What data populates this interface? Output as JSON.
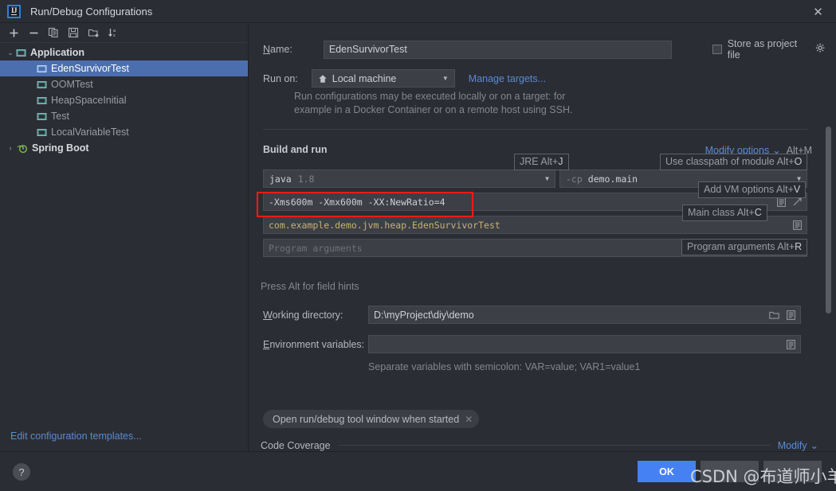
{
  "window": {
    "title": "Run/Debug Configurations",
    "logo_text": "IJ",
    "close_label": "✕"
  },
  "toolbar": {
    "items": [
      {
        "name": "add-configuration-button",
        "icon": "plus-icon",
        "label": "+"
      },
      {
        "name": "remove-configuration-button",
        "icon": "minus-icon",
        "label": "−"
      },
      {
        "name": "copy-configuration-button",
        "icon": "copy-icon",
        "label": ""
      },
      {
        "name": "save-configuration-button",
        "icon": "save-icon",
        "label": ""
      },
      {
        "name": "new-folder-button",
        "icon": "folder-add-icon",
        "label": ""
      },
      {
        "name": "sort-configurations-button",
        "icon": "sort-alphabetical-icon",
        "label": ""
      }
    ]
  },
  "sidebar": {
    "groups": [
      {
        "label": "Application",
        "expanded": true,
        "twisty": "⌄",
        "children": [
          {
            "label": "EdenSurvivorTest",
            "selected": true
          },
          {
            "label": "OOMTest",
            "selected": false
          },
          {
            "label": "HeapSpaceInitial",
            "selected": false
          },
          {
            "label": "Test",
            "selected": false
          },
          {
            "label": "LocalVariableTest",
            "selected": false
          }
        ]
      },
      {
        "label": "Spring Boot",
        "expanded": false,
        "twisty": "›",
        "children": []
      }
    ],
    "edit_templates_label": "Edit configuration templates..."
  },
  "form": {
    "name_label": "Name:",
    "name_value": "EdenSurvivorTest",
    "store_as_project_file_label": "Store as project file",
    "store_as_project_file_checked": false,
    "gear_icon": "gear-icon",
    "run_on_label": "Run on:",
    "run_on_value": "Local machine",
    "run_on_icon": "home-icon",
    "manage_targets_label": "Manage targets...",
    "run_on_hint_line1": "Run configurations may be executed locally or on a target: for",
    "run_on_hint_line2": "example in a Docker Container or on a remote host using SSH.",
    "build_and_run_label": "Build and run",
    "modify_options_label": "Modify options",
    "modify_options_chevron": "⌄",
    "modify_options_shortcut": "Alt+M",
    "jre_value": "java",
    "jre_version": "1.8",
    "classpath_prefix": "-cp",
    "classpath_value": "demo.main",
    "vm_options_value": "-Xms600m -Xmx600m -XX:NewRatio=4",
    "main_class_value": "com.example.demo.jvm.heap.EdenSurvivorTest",
    "program_arguments_placeholder": "Program arguments",
    "press_alt_hint": "Press Alt for field hints",
    "working_directory_label": "Working directory:",
    "working_directory_value": "D:\\myProject\\diy\\demo",
    "environment_variables_label": "Environment variables:",
    "environment_variables_value": "",
    "environment_hint": "Separate variables with semicolon: VAR=value; VAR1=value1",
    "open_tool_window_chip": "Open run/debug tool window when started",
    "chip_close": "✕",
    "code_coverage_label": "Code Coverage",
    "code_coverage_modify_label": "Modify",
    "code_coverage_modify_chevron": "⌄"
  },
  "tooltips": [
    {
      "name": "jre-hint",
      "text": "JRE Alt+",
      "mnemonic": "J"
    },
    {
      "name": "module-classpath-hint",
      "text": "Use classpath of module Alt+",
      "mnemonic": "O"
    },
    {
      "name": "vm-options-hint",
      "text": "Add VM options Alt+",
      "mnemonic": "V"
    },
    {
      "name": "main-class-hint",
      "text": "Main class Alt+",
      "mnemonic": "C"
    },
    {
      "name": "program-args-hint",
      "text": "Program arguments Alt+",
      "mnemonic": "R"
    }
  ],
  "footer": {
    "help_label": "?",
    "ok_label": "OK",
    "secondary_label": "",
    "tertiary_label": ""
  },
  "watermark": {
    "text": "CSDN @布道师小羊"
  },
  "colors": {
    "accent_blue": "#4681f4",
    "link_blue": "#5b8bd0",
    "selection_blue": "#4b6eaf",
    "highlight_red": "#ff1a14",
    "panel_bg": "#2b2d34",
    "field_bg": "#3c3f46"
  }
}
